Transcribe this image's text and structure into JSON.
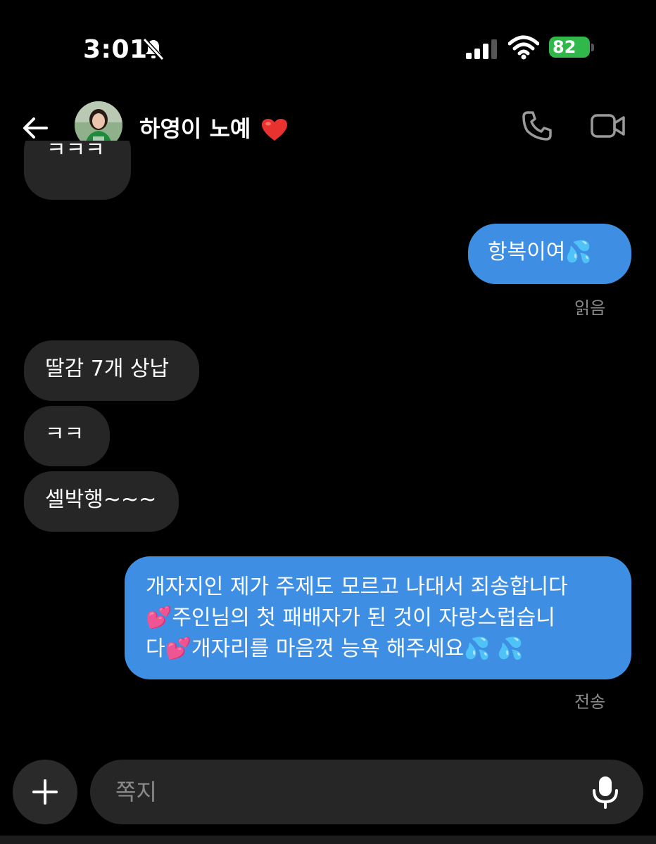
{
  "status": {
    "time": "3:01",
    "battery": "82"
  },
  "header": {
    "contact_name": "하영이 노예"
  },
  "messages": [
    {
      "direction": "incoming",
      "text": "ㅋㅋㅋ"
    },
    {
      "direction": "outgoing",
      "text": "항복이여💦"
    },
    {
      "direction": "incoming",
      "text": "딸감 7개 상납"
    },
    {
      "direction": "incoming",
      "text": "ㅋㅋ"
    },
    {
      "direction": "incoming",
      "text": "셀박행~~~"
    },
    {
      "direction": "outgoing",
      "lines": [
        "개자지인 제가 주제도 모르고 나대서 죄송합니다",
        "💕주인님의 첫 패배자가 된 것이 자랑스럽습니",
        "다💕개자리를 마음껏 능욕 해주세요💦 💦"
      ]
    }
  ],
  "receipts": {
    "read": "읽음",
    "sent": "전송"
  },
  "composer": {
    "placeholder": "쪽지"
  }
}
